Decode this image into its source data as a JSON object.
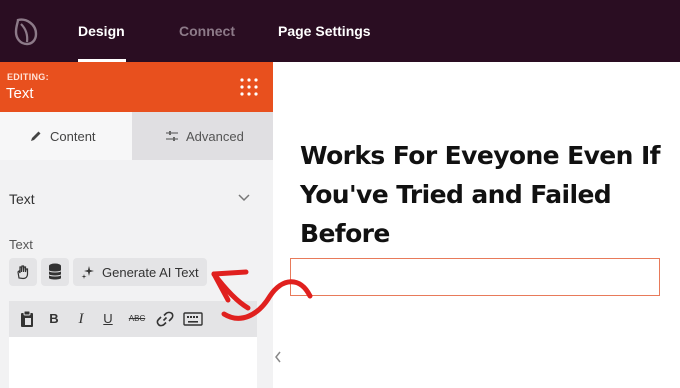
{
  "topbar": {
    "tabs": [
      {
        "label": "Design"
      },
      {
        "label": "Connect"
      },
      {
        "label": "Page Settings"
      }
    ]
  },
  "editing": {
    "small_label": "EDITING:",
    "title": "Text"
  },
  "panel_tabs": {
    "content": "Content",
    "advanced": "Advanced"
  },
  "section": {
    "title": "Text",
    "field_label": "Text",
    "generate_button": "Generate AI Text"
  },
  "toolbar": {
    "bold": "B",
    "italic": "I",
    "underline": "U",
    "strike": "ABC"
  },
  "canvas": {
    "heading": "Works For Eveyone Even If You've Tried and Failed Before"
  },
  "colors": {
    "topbar": "#2a0d22",
    "accent": "#e8501e",
    "arrow": "#e0201e"
  }
}
